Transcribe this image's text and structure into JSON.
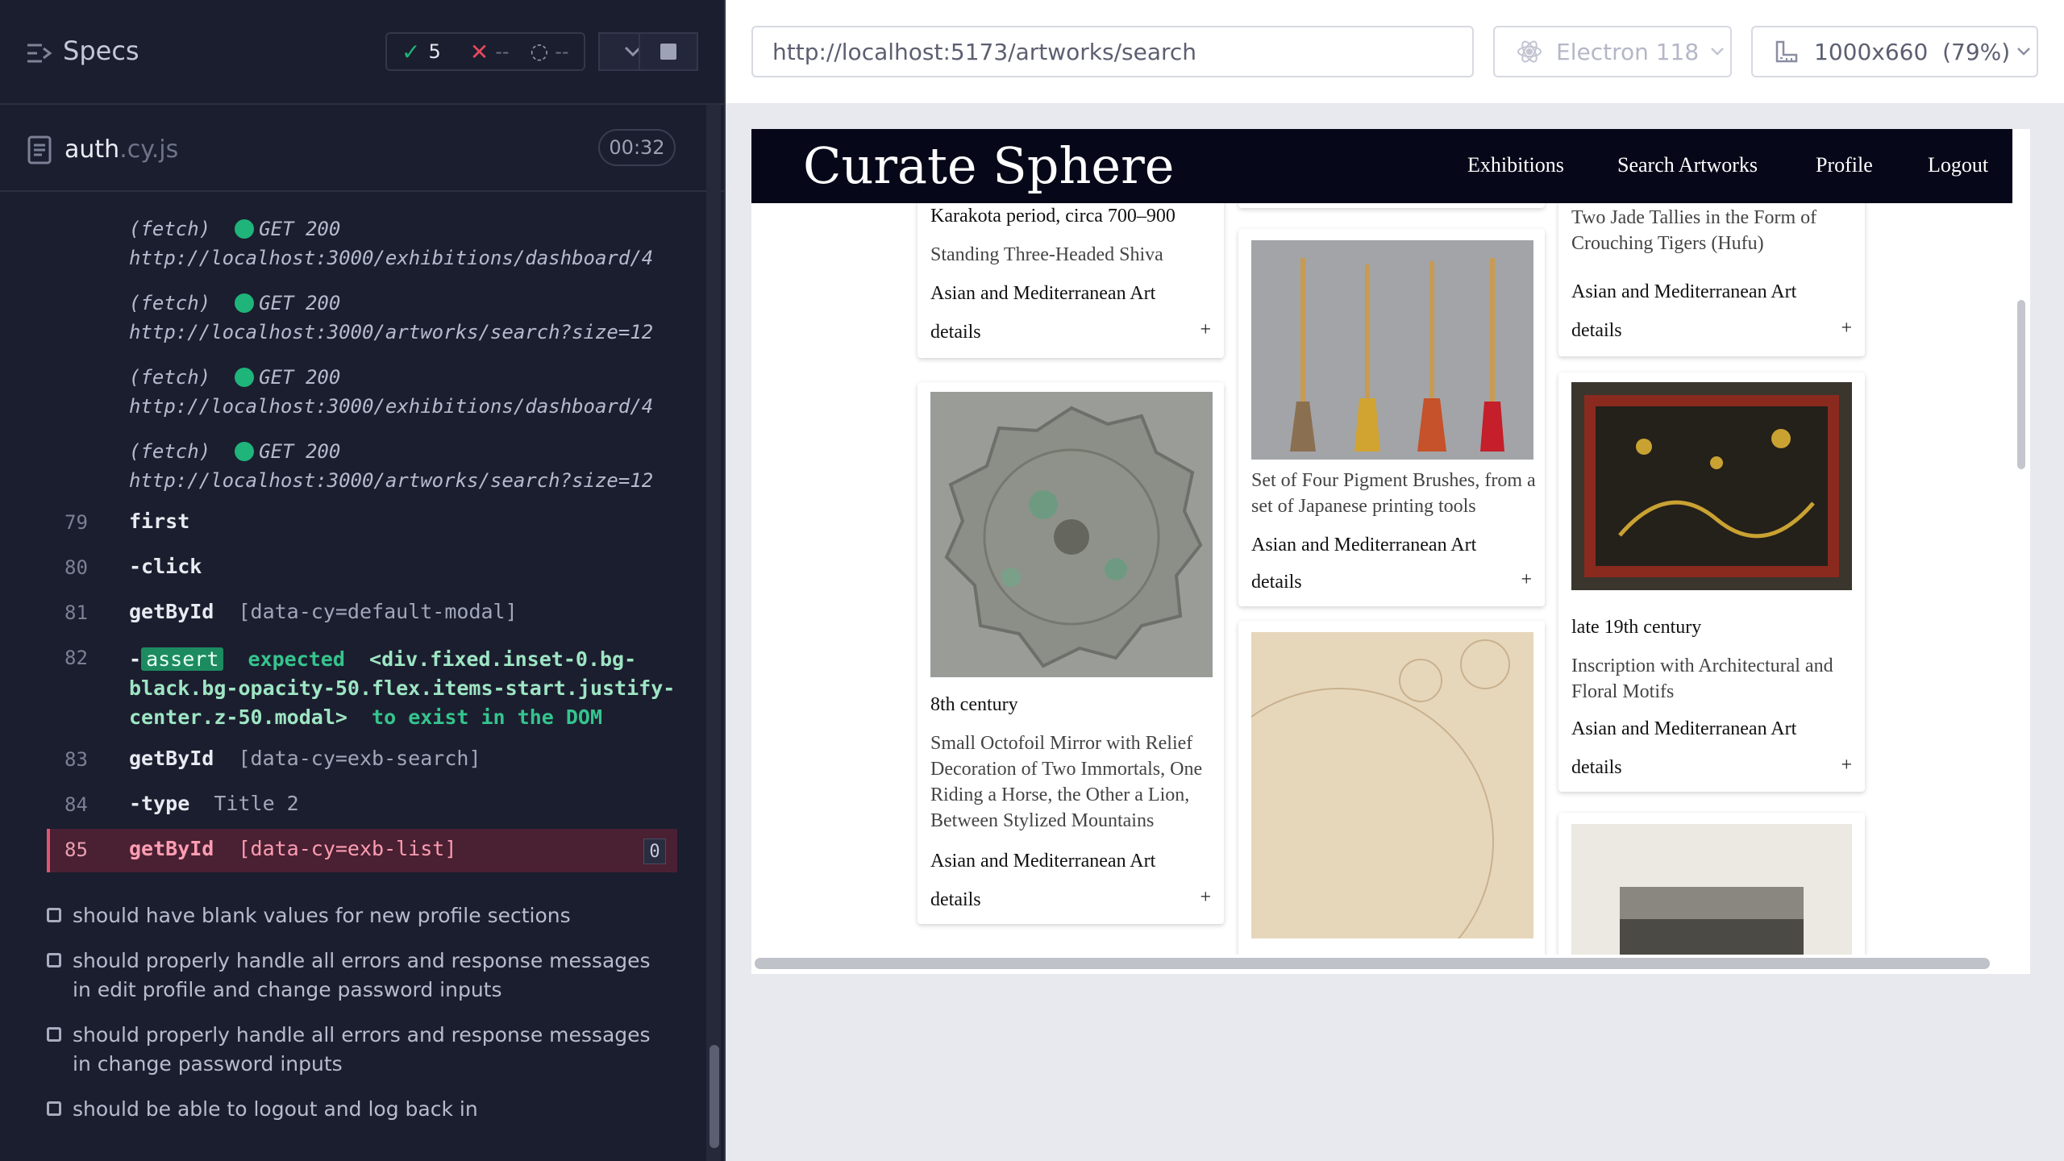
{
  "runner": {
    "title": "Specs",
    "passed": "5",
    "failed": "--",
    "pending": "--",
    "file_name": "auth",
    "file_ext": ".cy.js",
    "timer": "00:32"
  },
  "log": {
    "fetches": [
      {
        "label": "(fetch)",
        "method": "GET 200",
        "url": "http://localhost:3000/exhibitions/dashboard/4"
      },
      {
        "label": "(fetch)",
        "method": "GET 200",
        "url": "http://localhost:3000/artworks/search?size=12"
      },
      {
        "label": "(fetch)",
        "method": "GET 200",
        "url": "http://localhost:3000/exhibitions/dashboard/4"
      },
      {
        "label": "(fetch)",
        "method": "GET 200",
        "url": "http://localhost:3000/artworks/search?size=12"
      }
    ],
    "commands": [
      {
        "num": "79",
        "name": "first",
        "arg": ""
      },
      {
        "num": "80",
        "name": "-click",
        "arg": ""
      },
      {
        "num": "81",
        "name": "getById",
        "arg": "[data-cy=default-modal]"
      },
      {
        "num": "83",
        "name": "getById",
        "arg": "[data-cy=exb-search]"
      },
      {
        "num": "84",
        "name": "-type",
        "arg": "Title 2"
      },
      {
        "num": "85",
        "name": "getById",
        "arg": "[data-cy=exb-list]"
      }
    ],
    "assert": {
      "num": "82",
      "badge": "assert",
      "text1": "expected",
      "sel1": "<div.fixed.inset-0.bg-",
      "sel2": "black.bg-opacity-50.flex.items-start.justify-",
      "sel3": "center.z-50.modal>",
      "text2": "to exist in the DOM"
    },
    "active_count": "0"
  },
  "tests": [
    "should have blank values for new profile sections",
    "should properly handle all errors and response messages in edit profile and change password inputs",
    "should properly handle all errors and response messages in change password inputs",
    "should be able to logout and log back in"
  ],
  "browser_bar": {
    "url": "http://localhost:5173/artworks/search",
    "browser": "Electron 118",
    "viewport": "1000x660",
    "zoom": "(79%)"
  },
  "app": {
    "brand": "Curate Sphere",
    "nav": [
      "Exhibitions",
      "Search Artworks",
      "Profile",
      "Logout"
    ],
    "details_label": "details",
    "plus": "+",
    "cards": [
      {
        "date": "Karakota period, circa 700–900",
        "title": "Standing Three-Headed Shiva",
        "dept": "Asian and Mediterranean Art"
      },
      {
        "date": "",
        "title": "Two Jade Tallies in the Form of Crouching Tigers (Hufu)",
        "dept": "Asian and Mediterranean Art"
      },
      {
        "date": "8th century",
        "title": "Small Octofoil Mirror with Relief Decoration of Two Immortals, One Riding a Horse, the Other a Lion, Between Stylized Mountains",
        "dept": "Asian and Mediterranean Art"
      },
      {
        "date": "",
        "title": "Set of Four Pigment Brushes, from a set of Japanese printing tools",
        "dept": "Asian and Mediterranean Art"
      },
      {
        "date": "late 19th century",
        "title": "Inscription with Architectural and Floral Motifs",
        "dept": "Asian and Mediterranean Art"
      }
    ]
  }
}
